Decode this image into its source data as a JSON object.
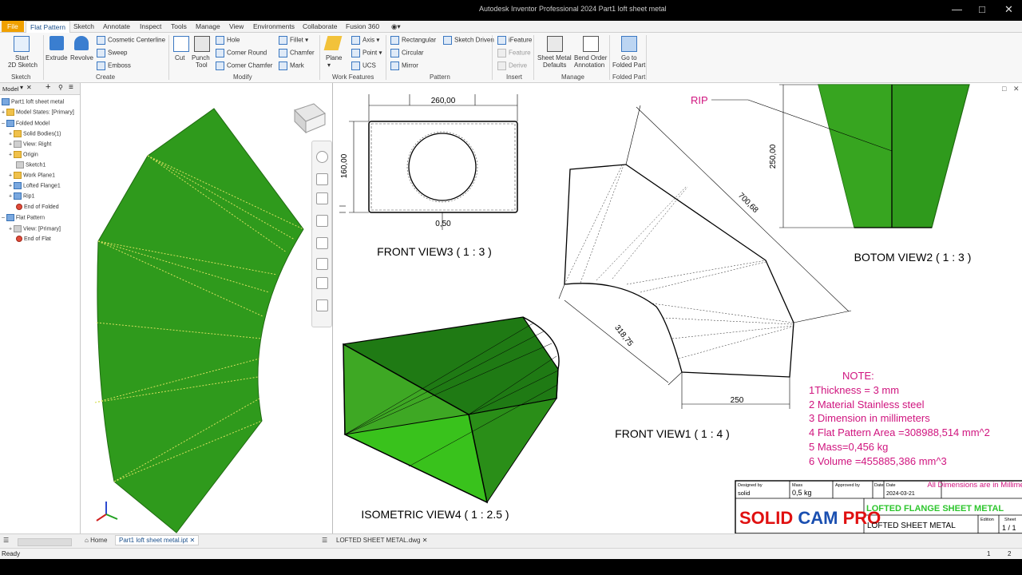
{
  "titlebar": {
    "app_title": "Autodesk Inventor Professional 2024  Part1 loft sheet metal"
  },
  "tabs": [
    "File",
    "Flat Pattern",
    "Sketch",
    "Annotate",
    "Inspect",
    "Tools",
    "Manage",
    "View",
    "Environments",
    "Collaborate",
    "Fusion 360"
  ],
  "ribbon": {
    "sketch": {
      "start_line1": "Start",
      "start_line2": "2D Sketch",
      "title": "Sketch"
    },
    "create": {
      "extrude": "Extrude",
      "revolve": "Revolve",
      "cosmetic": "Cosmetic Centerline",
      "sweep": "Sweep",
      "emboss": "Emboss",
      "title": "Create"
    },
    "modify": {
      "cut": "Cut",
      "punch_line1": "Punch",
      "punch_line2": "Tool",
      "hole": "Hole",
      "corner_round": "Corner Round",
      "corner_chamfer": "Corner Chamfer",
      "fillet": "Fillet",
      "chamfer": "Chamfer",
      "mark": "Mark",
      "title": "Modify"
    },
    "work": {
      "plane": "Plane",
      "axis": "Axis",
      "point": "Point",
      "ucs": "UCS",
      "title": "Work Features"
    },
    "pattern": {
      "rectangular": "Rectangular",
      "circular": "Circular",
      "mirror": "Mirror",
      "sketch_driven": "Sketch Driven",
      "title": "Pattern"
    },
    "insert": {
      "ifeature": "iFeature",
      "feature": "Feature",
      "derive": "Derive",
      "title": "Insert"
    },
    "manage": {
      "smd_line1": "Sheet Metal",
      "smd_line2": "Defaults",
      "bend_line1": "Bend Order",
      "bend_line2": "Annotation",
      "title": "Manage"
    },
    "folded": {
      "goto_line1": "Go to",
      "goto_line2": "Folded Part",
      "title": "Folded Part"
    }
  },
  "browser": {
    "header": "Model",
    "items": [
      "Part1 loft sheet metal",
      "Model States: [Primary]",
      "Folded Model",
      "Solid Bodies(1)",
      "View: Right",
      "Origin",
      "Sketch1",
      "Work Plane1",
      "Lofted Flange1",
      "Rip1",
      "End of Folded",
      "Flat Pattern",
      "View: [Primary]",
      "End of Flat"
    ]
  },
  "drawing": {
    "rip_label": "RIP",
    "front3": {
      "width": "260,00",
      "height": "160,00",
      "gap": "0,50",
      "title": "FRONT VIEW3 ( 1 : 3 )"
    },
    "bottom2": {
      "height": "250,00",
      "title": "BOTOM VIEW2 ( 1 : 3 )"
    },
    "front1": {
      "dim_long": "700,68",
      "dim_arc": "318,75",
      "dim_base": "250",
      "title": "FRONT VIEW1 ( 1 : 4 )"
    },
    "iso4": {
      "title": "ISOMETRIC VIEW4  ( 1 : 2.5 )"
    },
    "notes": {
      "heading": "NOTE:",
      "lines": [
        "1Thickness = 3 mm",
        "2 Material Stainless steel",
        "3 Dimension in millimeters",
        "4 Flat Pattern Area =308988,514 mm^2",
        "5 Mass=0,456 kg",
        "6 Volume =455885,386 mm^3"
      ]
    },
    "titleblock": {
      "designed_by_label": "Designed by",
      "designed_by": "solid",
      "mass_label": "Mass",
      "mass": "0,5 kg",
      "approved_label": "Approved by",
      "date_label1": "Date",
      "date_label2": "Date",
      "date": "2024-03-21",
      "all_dims": "All Dimensions are in Millimeters",
      "logo": "SOLID CAM PRO",
      "title1": "LOFTED FLANGE SHEET METAL",
      "title2": "LOFTED SHEET METAL",
      "edition_label": "Edition",
      "sheet_label": "Sheet",
      "sheet": "1 / 1"
    }
  },
  "doc_tabs": {
    "home": "Home",
    "part": "Part1 loft sheet metal.ipt",
    "dwg": "LOFTED SHEET METAL.dwg"
  },
  "status": {
    "ready": "Ready",
    "page1": "1",
    "page2": "2"
  },
  "colors": {
    "green": "#2f9a1c",
    "green_dark": "#1f6a10",
    "note_magenta": "#d0157f",
    "logo_red": "#e01010",
    "logo_blue": "#1a4fb0",
    "title_green": "#2ec62e"
  }
}
